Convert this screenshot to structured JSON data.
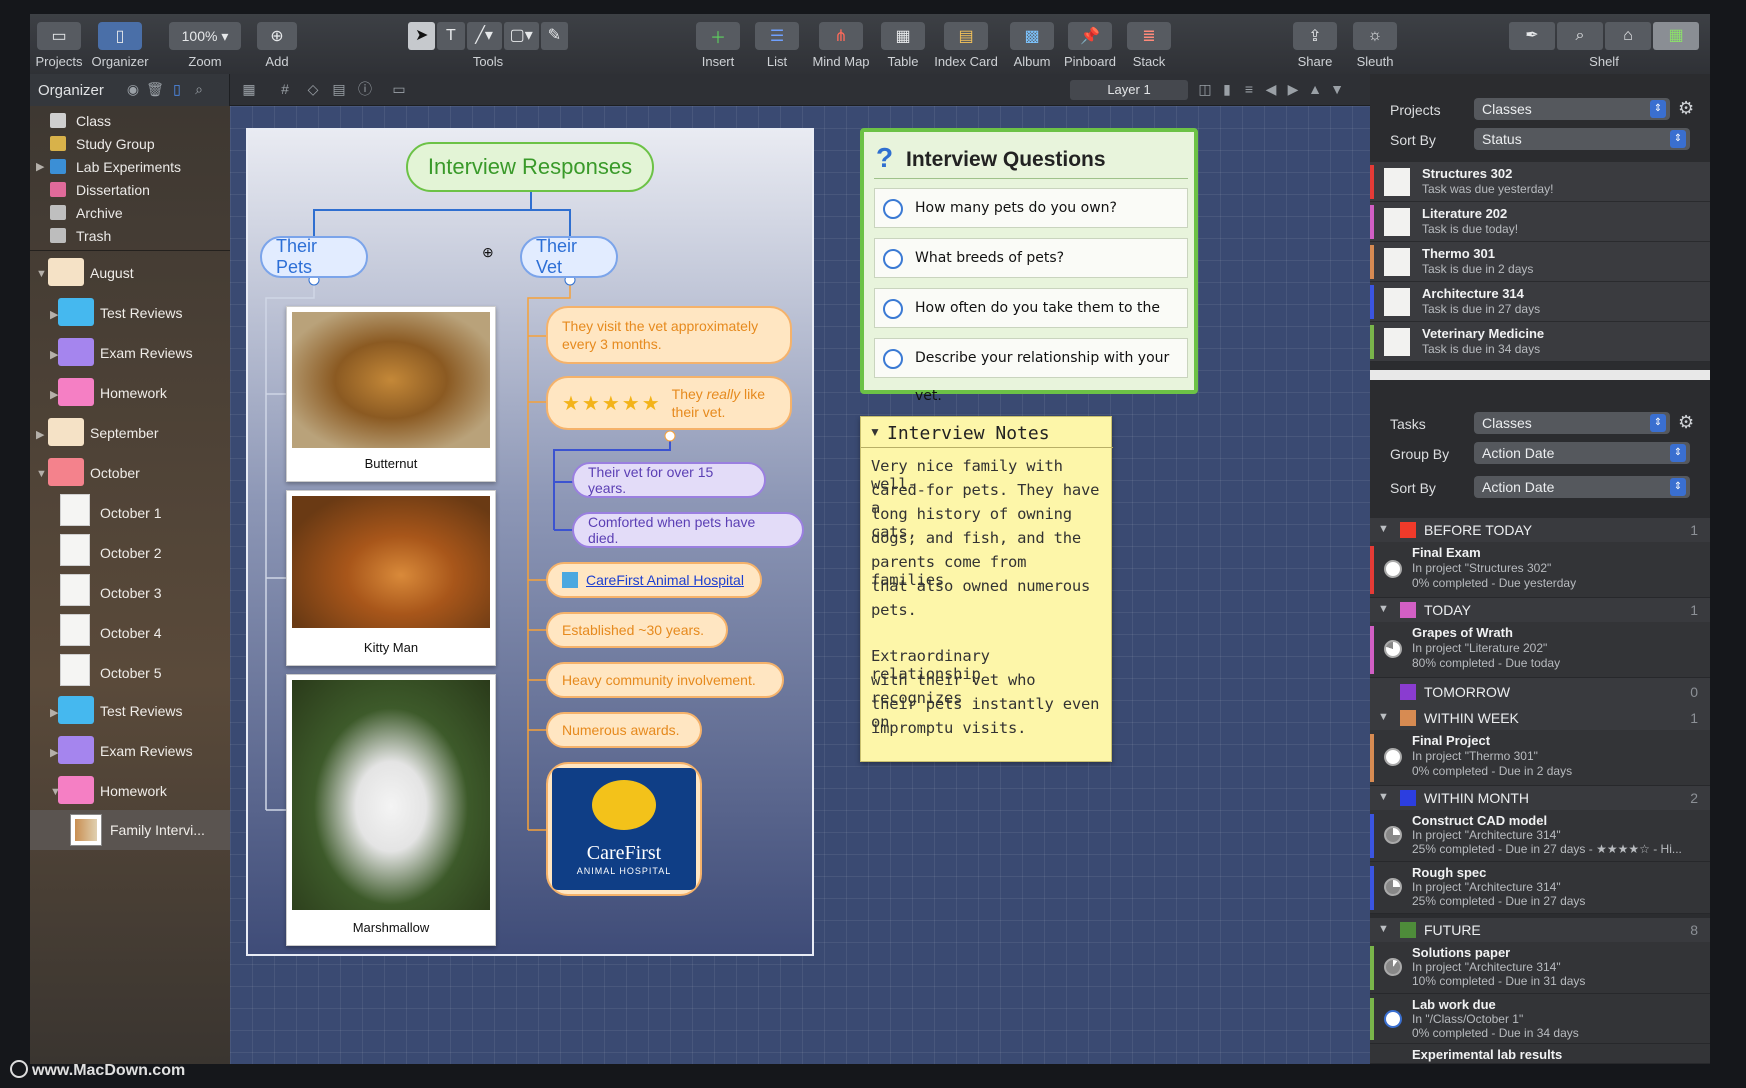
{
  "toolbar": {
    "projects": "Projects",
    "organizer": "Organizer",
    "zoom_value": "100%",
    "zoom": "Zoom",
    "add": "Add",
    "tools": "Tools",
    "insert": "Insert",
    "list": "List",
    "mindmap": "Mind Map",
    "table": "Table",
    "indexcard": "Index Card",
    "album": "Album",
    "pinboard": "Pinboard",
    "stack": "Stack",
    "share": "Share",
    "sleuth": "Sleuth",
    "shelf": "Shelf"
  },
  "organizer": {
    "title": "Organizer",
    "layer": "Layer 1"
  },
  "sidebar": {
    "top": [
      {
        "label": "Class",
        "color": "#cfcfcf"
      },
      {
        "label": "Study Group",
        "color": "#d8b24a"
      },
      {
        "label": "Lab Experiments",
        "color": "#3b8fd6"
      },
      {
        "label": "Dissertation",
        "color": "#e06a9a"
      },
      {
        "label": "Archive",
        "color": "#bfbfbf"
      },
      {
        "label": "Trash",
        "color": "#bdbdbd"
      }
    ],
    "august": "August",
    "test_reviews": "Test Reviews",
    "exam_reviews": "Exam Reviews",
    "homework": "Homework",
    "september": "September",
    "october": "October",
    "oct_docs": [
      "October 1",
      "October 2",
      "October 3",
      "October 4",
      "October 5"
    ],
    "test_reviews2": "Test Reviews",
    "exam_reviews2": "Exam Reviews",
    "homework2": "Homework",
    "family": "Family Intervi..."
  },
  "mindmap": {
    "root": "Interview Responses",
    "pets": "Their Pets",
    "vet": "Their Vet",
    "photos": [
      "Butternut",
      "Kitty Man",
      "Marshmallow"
    ],
    "vet1": "They visit the vet approximately every 3 months.",
    "stars": "★★★★★",
    "vet2a": "They ",
    "vet2b": "really",
    "vet2c": " like their vet.",
    "sub1": "Their vet for over 15 years.",
    "sub2": "Comforted when pets have died.",
    "link": "CareFirst Animal Hospital",
    "est": "Established ~30 years.",
    "comm": "Heavy community involvement.",
    "awards": "Numerous awards.",
    "logo1": "CareFirst",
    "logo2": "ANIMAL HOSPITAL"
  },
  "questions": {
    "title": "Interview Questions",
    "items": [
      "How many pets do you own?",
      "What breeds of pets?",
      "How often do you take them to the vet?",
      "Describe your relationship with your vet."
    ]
  },
  "notes": {
    "title": "Interview Notes",
    "lines": [
      "Very nice family with well-",
      "cared-for pets. They have a",
      "long history of owning cats,",
      "dogs, and fish, and the",
      "parents come from families",
      "that also owned numerous",
      "pets.",
      "",
      "Extraordinary relationship",
      "with their vet who recognizes",
      "their pets instantly even on",
      "impromptu visits."
    ]
  },
  "right": {
    "projects_label": "Projects",
    "projects_value": "Classes",
    "sortby_label": "Sort By",
    "sortby_value": "Status",
    "projects": [
      {
        "title": "Structures 302",
        "sub": "Task was due yesterday!",
        "color": "#e53b36"
      },
      {
        "title": "Literature 202",
        "sub": "Task is due today!",
        "color": "#d25fc4"
      },
      {
        "title": "Thermo 301",
        "sub": "Task is due in 2 days",
        "color": "#d78b52"
      },
      {
        "title": "Architecture 314",
        "sub": "Task is due in 27 days",
        "color": "#3b55e0"
      },
      {
        "title": "Veterinary Medicine",
        "sub": "Task is due in 34 days",
        "color": "#7ab54a"
      }
    ],
    "tasks_label": "Tasks",
    "tasks_value": "Classes",
    "groupby_label": "Group By",
    "groupby_value": "Action Date",
    "sortby2_label": "Sort By",
    "sortby2_value": "Action Date",
    "groups": {
      "before": "BEFORE TODAY",
      "before_c": "1",
      "today": "TODAY",
      "today_c": "1",
      "tomorrow": "TOMORROW",
      "tomorrow_c": "0",
      "week": "WITHIN WEEK",
      "week_c": "1",
      "month": "WITHIN MONTH",
      "month_c": "2",
      "future": "FUTURE",
      "future_c": "8"
    },
    "tasks": {
      "t1": {
        "title": "Final Exam",
        "l1": "In project \"Structures 302\"",
        "l2": "0% completed - Due yesterday"
      },
      "t2": {
        "title": "Grapes of Wrath",
        "l1": "In project \"Literature 202\"",
        "l2": "80% completed - Due today"
      },
      "t3": {
        "title": "Final Project",
        "l1": "In project \"Thermo 301\"",
        "l2": "0% completed - Due in 2 days"
      },
      "t4": {
        "title": "Construct CAD model",
        "l1": "In project \"Architecture 314\"",
        "l2": "25% completed - Due in 27 days - ★★★★☆ - Hi..."
      },
      "t5": {
        "title": "Rough spec",
        "l1": "In project \"Architecture 314\"",
        "l2": "25% completed - Due in 27 days"
      },
      "t6": {
        "title": "Solutions paper",
        "l1": "In project \"Architecture 314\"",
        "l2": "10% completed - Due in 31 days"
      },
      "t7": {
        "title": "Lab work due",
        "l1": "In \"/Class/October 1\"",
        "l2": "0% completed - Due in 34 days"
      },
      "t8": {
        "title": "Experimental lab results"
      }
    }
  },
  "watermark": "www.MacDown.com",
  "colors": {
    "accent": "#3a6fd0",
    "mindmap_orange": "#f5b26a",
    "mindmap_purple": "#9a7fe0",
    "questions_green": "#6cc246"
  }
}
